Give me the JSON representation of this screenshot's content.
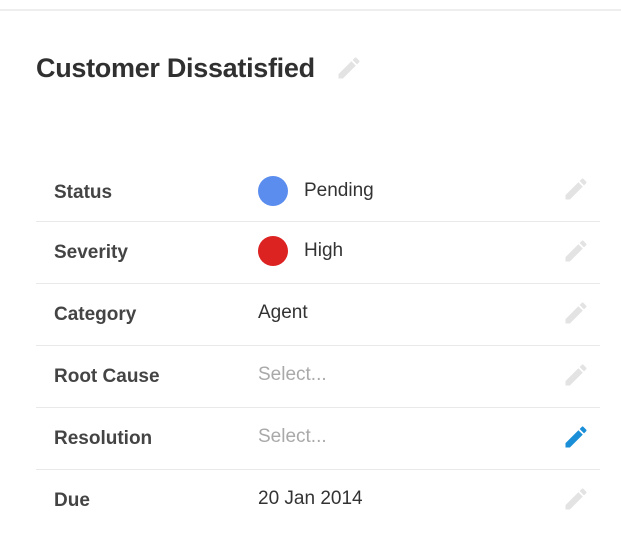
{
  "header": {
    "title": "Customer Dissatisfied",
    "edit_icon": "pencil-icon"
  },
  "fields": [
    {
      "label": "Status",
      "value": "Pending",
      "dot_color": "#5b8def",
      "placeholder": false,
      "active_edit": false
    },
    {
      "label": "Severity",
      "value": "High",
      "dot_color": "#dd2222",
      "placeholder": false,
      "active_edit": false
    },
    {
      "label": "Category",
      "value": "Agent",
      "placeholder": false,
      "active_edit": false
    },
    {
      "label": "Root Cause",
      "value": "Select...",
      "placeholder": true,
      "active_edit": false
    },
    {
      "label": "Resolution",
      "value": "Select...",
      "placeholder": true,
      "active_edit": true
    },
    {
      "label": "Due",
      "value": "20 Jan 2014",
      "placeholder": false,
      "active_edit": false
    }
  ],
  "colors": {
    "pencil_inactive": "#e3e3e3",
    "pencil_active": "#1a8fd8",
    "placeholder_text": "#a9a9a9",
    "row_divider": "#e9e9e9"
  }
}
